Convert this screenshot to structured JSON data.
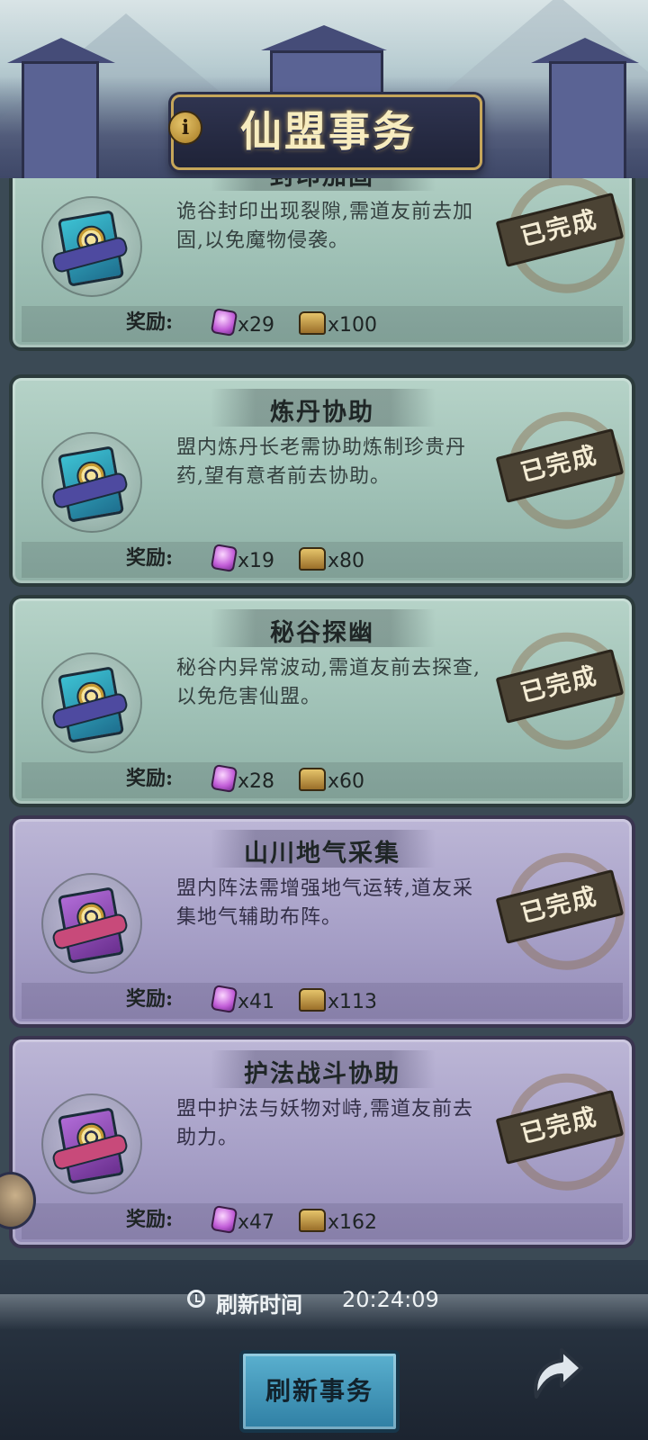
{
  "header": {
    "title": "仙盟事务",
    "info_icon": "i"
  },
  "tasks": [
    {
      "title": "封印加固",
      "theme": "green",
      "description": "诡谷封印出现裂隙,需道友前去加固,以免魔物侵袭。",
      "status": "已完成",
      "reward_label": "奖励:",
      "gem_amount": "x29",
      "chest_amount": "x100"
    },
    {
      "title": "炼丹协助",
      "theme": "green",
      "description": "盟内炼丹长老需协助炼制珍贵丹药,望有意者前去协助。",
      "status": "已完成",
      "reward_label": "奖励:",
      "gem_amount": "x19",
      "chest_amount": "x80"
    },
    {
      "title": "秘谷探幽",
      "theme": "green",
      "description": "秘谷内异常波动,需道友前去探查,以免危害仙盟。",
      "status": "已完成",
      "reward_label": "奖励:",
      "gem_amount": "x28",
      "chest_amount": "x60"
    },
    {
      "title": "山川地气采集",
      "theme": "purple",
      "description": "盟内阵法需增强地气运转,道友采集地气辅助布阵。",
      "status": "已完成",
      "reward_label": "奖励:",
      "gem_amount": "x41",
      "chest_amount": "x113"
    },
    {
      "title": "护法战斗协助",
      "theme": "purple",
      "description": "盟中护法与妖物对峙,需道友前去助力。",
      "status": "已完成",
      "reward_label": "奖励:",
      "gem_amount": "x47",
      "chest_amount": "x162"
    }
  ],
  "footer": {
    "refresh_label": "刷新时间",
    "refresh_time": "20:24:09",
    "refresh_button": "刷新事务"
  },
  "icons": {
    "gem": "gem-icon",
    "chest": "chest-icon",
    "clock": "clock-icon",
    "back": "curved-arrow-icon",
    "task": "scroll-book-icon"
  },
  "colors": {
    "green_card": "#a8c8bd",
    "purple_card": "#aaa3ca",
    "stamp": "#4b4334",
    "button": "#3f93b8",
    "title_gold": "#f7ecbf"
  }
}
